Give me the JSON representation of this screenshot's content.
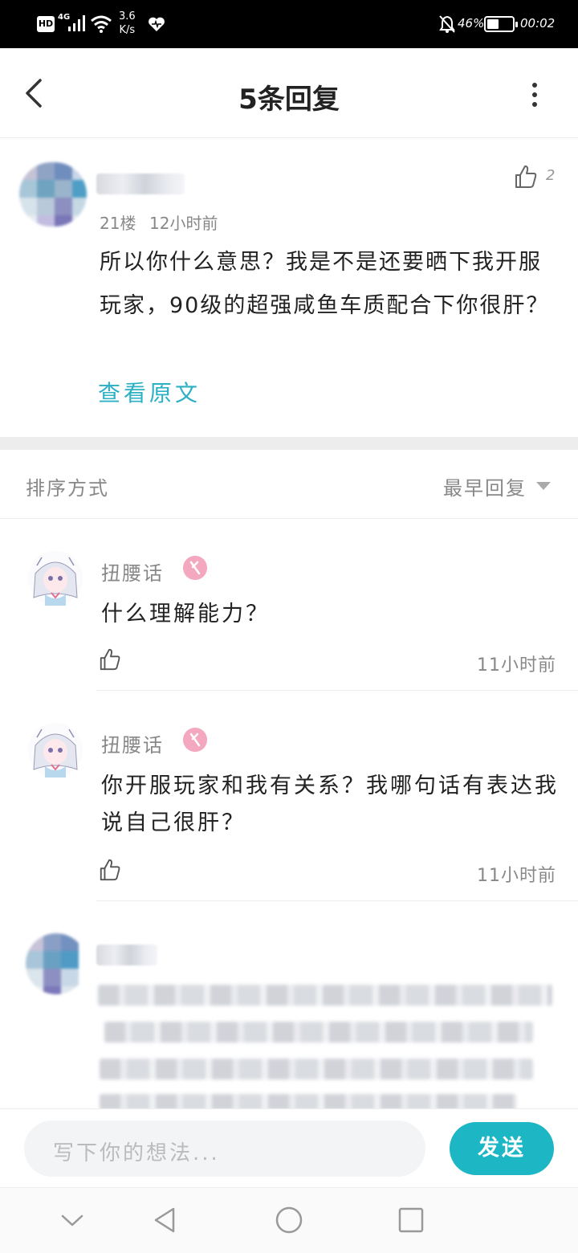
{
  "status_bar": {
    "hd": "HD",
    "network": "4G",
    "speed_value": "3.6",
    "speed_unit": "K/s",
    "battery_percent": "46%",
    "battery_level": 0.46,
    "time": "00:02"
  },
  "header": {
    "title": "5条回复"
  },
  "original_post": {
    "floor": "21楼",
    "time": "12小时前",
    "like_count": "2",
    "text": "所以你什么意思？我是不是还要晒下我开服玩家，90级的超强咸鱼车质配合下你很肝？",
    "view_original": "查看原文"
  },
  "sort": {
    "label": "排序方式",
    "value": "最早回复"
  },
  "replies": [
    {
      "name": "扭腰话",
      "text": "什么理解能力？",
      "time": "11小时前"
    },
    {
      "name": "扭腰话",
      "text": "你开服玩家和我有关系？我哪句话有表达我说自己很肝？",
      "time": "11小时前"
    }
  ],
  "input": {
    "placeholder": "写下你的想法...",
    "send_label": "发送"
  },
  "colors": {
    "accent": "#1db6c4",
    "link": "#2bb0c4",
    "badge": "#f4a8c0"
  },
  "icons": [
    "back-arrow-icon",
    "more-vert-icon",
    "thumbs-up-icon",
    "caret-down-icon",
    "heart-icon",
    "wifi-icon",
    "signal-icon",
    "bell-off-icon",
    "battery-icon",
    "nav-back-icon",
    "nav-home-icon",
    "nav-recents-icon",
    "nav-collapse-icon"
  ]
}
